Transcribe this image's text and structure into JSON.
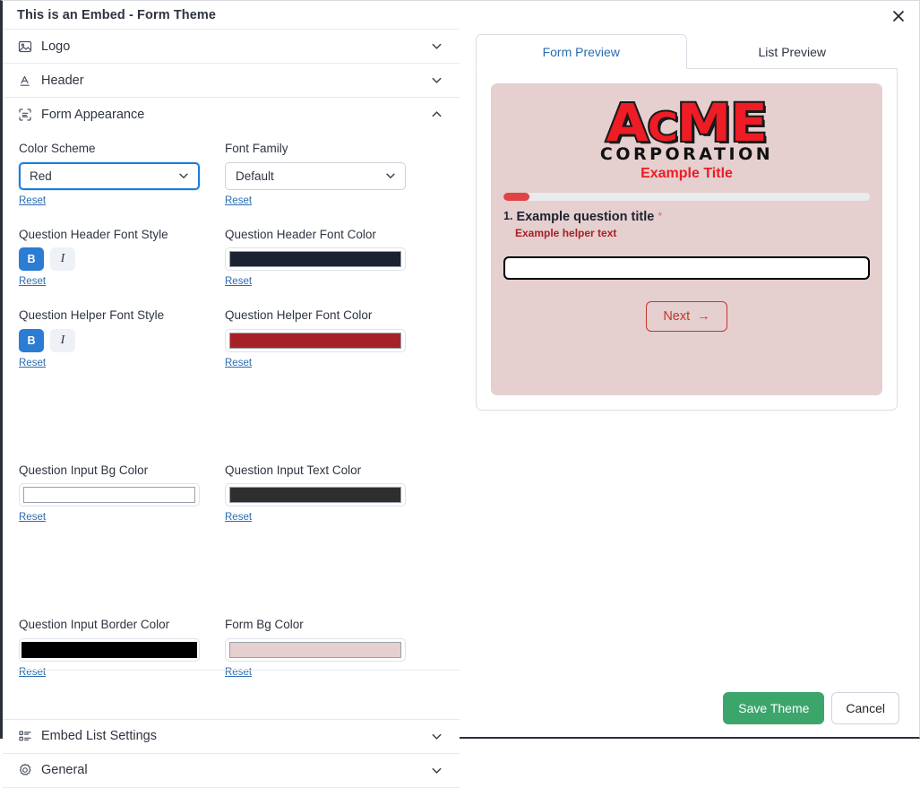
{
  "window": {
    "title": "This is an Embed - Form Theme",
    "close_icon": "close-icon"
  },
  "accordion": {
    "sections": [
      {
        "label": "Logo",
        "icon": "image-icon",
        "expanded": false,
        "chevron": "chevron-down-icon"
      },
      {
        "label": "Header",
        "icon": "text-underline-icon",
        "expanded": false,
        "chevron": "chevron-down-icon"
      },
      {
        "label": "Form Appearance",
        "icon": "form-scan-icon",
        "expanded": true,
        "chevron": "chevron-up-icon"
      },
      {
        "label": "Embed List Settings",
        "icon": "list-settings-icon",
        "expanded": false,
        "chevron": "chevron-down-icon"
      },
      {
        "label": "General",
        "icon": "gear-icon",
        "expanded": false,
        "chevron": "chevron-down-icon"
      }
    ]
  },
  "appearance": {
    "reset_label": "Reset",
    "bold_label": "B",
    "italic_label": "I",
    "fields": [
      {
        "label": "Color Scheme",
        "type": "select",
        "value": "Red",
        "focused": true
      },
      {
        "label": "Font Family",
        "type": "select",
        "value": "Default",
        "focused": false
      },
      {
        "label": "Question Header Font Style",
        "type": "fontstyle",
        "bold_active": true,
        "italic_active": false
      },
      {
        "label": "Question Header Font Color",
        "type": "color",
        "value": "#1b2330",
        "full": false
      },
      {
        "label": "Question Helper Font Style",
        "type": "fontstyle",
        "bold_active": true,
        "italic_active": false
      },
      {
        "label": "Question Helper Font Color",
        "type": "color",
        "value": "#a62126",
        "full": false
      },
      {
        "label": "Question Input Bg Color",
        "type": "color",
        "value": "#ffffff",
        "full": false
      },
      {
        "label": "Question Input Text Color",
        "type": "color",
        "value": "#2e2e2e",
        "full": false
      },
      {
        "label": "Question Input Border Color",
        "type": "color",
        "value": "#000000",
        "full": true
      },
      {
        "label": "Form Bg Color",
        "type": "color",
        "value": "#e5cfcf",
        "full": false
      }
    ]
  },
  "preview": {
    "tabs": [
      {
        "label": "Form Preview",
        "active": true
      },
      {
        "label": "List Preview",
        "active": false
      }
    ],
    "form": {
      "bg_color": "#e5cfcf",
      "logo": {
        "line1_a": "A",
        "line1_c": "C",
        "line1_me": "ME",
        "line2": "CORPORATION"
      },
      "title": "Example Title",
      "title_color": "#ee1c25",
      "progress": {
        "percent": 7,
        "fill_color": "#e04343",
        "track_color": "#e9ecef"
      },
      "question": {
        "number": "1.",
        "title": "Example question title",
        "required_mark": "*",
        "required_color": "#e06666",
        "title_color": "#1b2330",
        "helper": "Example helper text",
        "helper_color": "#a62126",
        "input_bg": "#ffffff",
        "input_border": "#000000"
      },
      "next_button": {
        "label": "Next",
        "arrow": "→",
        "color": "#c0392b",
        "border_color": "#c0392b"
      }
    }
  },
  "footer": {
    "save_label": "Save Theme",
    "cancel_label": "Cancel",
    "save_color": "#3ca56c"
  }
}
